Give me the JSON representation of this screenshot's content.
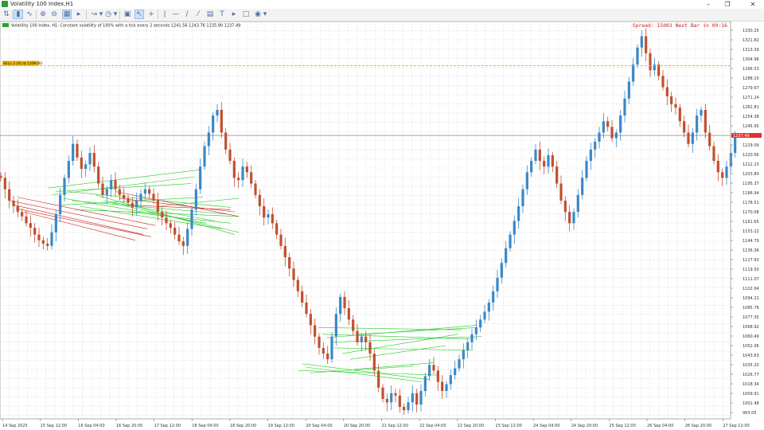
{
  "window": {
    "title": "Volatility 100 Index,H1"
  },
  "toolbar": {
    "icons": [
      "new-order-icon",
      "bar-chart-icon",
      "candles-icon",
      "line-chart-icon",
      "zoom-in-icon",
      "zoom-out-icon",
      "tile-icon",
      "autoscroll-icon",
      "indicators-icon",
      "periods-icon",
      "template-icon",
      "cursor-icon",
      "crosshair-icon",
      "vertical-line-icon",
      "horizontal-line-icon",
      "trendline-icon",
      "channel-icon",
      "text-icon",
      "label-icon",
      "shapes-icon",
      "arrows-icon"
    ]
  },
  "chart_info": {
    "text": "Volatility 100 Index, H1:  Constant volatility of 100% with a tick every 2 seconds  1241.56 1243.76 1235.90 1237.49"
  },
  "spread_info": {
    "text": "Spread: 15003 Next Bar in 00:16"
  },
  "level": {
    "label": "SELL 1.00 at 1299.00",
    "value": 1299.0
  },
  "current_price": {
    "value": 1237.49,
    "label": "1237.49"
  },
  "colors": {
    "bull": "#3a88c7",
    "bear": "#c0502f",
    "grid": "#c8c8c8",
    "level": "#f0b400",
    "green_lines": "#22cc22",
    "red_lines": "#d02020",
    "price_tag": "#e03030"
  },
  "chart_data": {
    "type": "candlestick",
    "y_ticks": [
      1330.25,
      1321.82,
      1313.39,
      1304.96,
      1296.53,
      1288.1,
      1279.67,
      1271.24,
      1262.81,
      1254.38,
      1245.95,
      1237.52,
      1229.09,
      1220.66,
      1212.23,
      1203.8,
      1195.37,
      1186.94,
      1178.51,
      1170.08,
      1161.65,
      1153.22,
      1144.79,
      1136.36,
      1127.93,
      1119.5,
      1111.07,
      1102.64,
      1094.21,
      1085.78,
      1077.35,
      1068.92,
      1060.49,
      1052.06,
      1043.63,
      1035.2,
      1026.77,
      1018.34,
      1009.91,
      1001.48,
      993.05
    ],
    "y_ticks_text": [
      "1330.25",
      "1321.82",
      "1313.39",
      "1304.96",
      "1296.53",
      "1288.10",
      "1279.67",
      "1271.24",
      "1262.81",
      "1254.38",
      "1245.95",
      "1237.52",
      "1229.09",
      "1220.66",
      "1212.23",
      "1203.80",
      "1195.37",
      "1186.94",
      "1178.51",
      "1170.08",
      "1161.65",
      "1153.22",
      "1144.79",
      "1136.36",
      "1127.93",
      "1119.50",
      "1111.07",
      "1102.64",
      "1094.21",
      "1085.78",
      "1077.35",
      "1068.92",
      "1060.49",
      "1052.06",
      "1043.63",
      "1035.20",
      "1026.77",
      "1018.34",
      "1009.91",
      "1001.48",
      "993.05"
    ],
    "x_ticks": [
      "14 Sep 2025",
      "15 Sep 12:00",
      "16 Sep 04:00",
      "16 Sep 20:00",
      "17 Sep 12:00",
      "18 Sep 04:00",
      "18 Sep 20:00",
      "19 Sep 12:00",
      "20 Sep 04:00",
      "20 Sep 20:00",
      "21 Sep 12:00",
      "22 Sep 04:00",
      "22 Sep 20:00",
      "23 Sep 12:00",
      "24 Sep 04:00",
      "24 Sep 20:00",
      "25 Sep 12:00",
      "26 Sep 04:00",
      "26 Sep 20:00",
      "27 Sep 12:00"
    ],
    "ylim": [
      990,
      1336
    ],
    "series": [
      {
        "close": [
          1200,
          1190,
          1180,
          1175,
          1170,
          1166,
          1160,
          1156,
          1150,
          1145,
          1142,
          1140,
          1152,
          1168,
          1185,
          1200,
          1215,
          1230,
          1218,
          1208,
          1212,
          1222,
          1210,
          1195,
          1185,
          1190,
          1198,
          1190,
          1185,
          1182,
          1178,
          1174,
          1180,
          1186,
          1190,
          1186,
          1180,
          1170,
          1165,
          1160,
          1156,
          1150,
          1144,
          1140,
          1155,
          1172,
          1190,
          1210,
          1228,
          1240,
          1255,
          1260,
          1240,
          1225,
          1215,
          1200,
          1198,
          1210,
          1205,
          1195,
          1185,
          1175,
          1165,
          1168,
          1160,
          1150,
          1140,
          1130,
          1120,
          1110,
          1100,
          1090,
          1080,
          1070,
          1060,
          1050,
          1045,
          1040,
          1060,
          1080,
          1095,
          1085,
          1075,
          1065,
          1055,
          1060,
          1055,
          1045,
          1030,
          1015,
          1005,
          1002,
          1010,
          1008,
          998,
          995,
          1002,
          1010,
          1000,
          1012,
          1025,
          1035,
          1030,
          1020,
          1012,
          1018,
          1026,
          1032,
          1040,
          1048,
          1055,
          1062,
          1068,
          1075,
          1082,
          1090,
          1100,
          1112,
          1125,
          1138,
          1150,
          1162,
          1175,
          1190,
          1205,
          1215,
          1225,
          1215,
          1210,
          1220,
          1210,
          1195,
          1180,
          1170,
          1160,
          1170,
          1185,
          1200,
          1215,
          1225,
          1232,
          1240,
          1250,
          1245,
          1235,
          1240,
          1255,
          1270,
          1285,
          1300,
          1315,
          1325,
          1310,
          1295,
          1300,
          1290,
          1280,
          1272,
          1265,
          1262,
          1250,
          1240,
          1230,
          1240,
          1255,
          1260,
          1240,
          1228,
          1215,
          1205,
          1200,
          1210,
          1222,
          1237.49
        ]
      }
    ]
  }
}
